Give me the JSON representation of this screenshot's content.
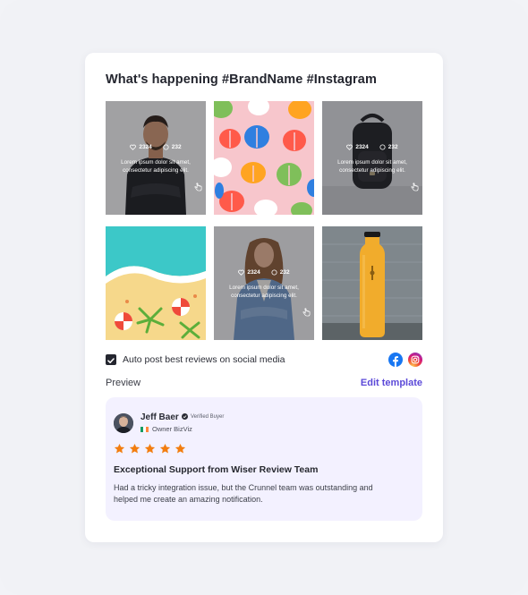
{
  "widget": {
    "title": "What's happening #BrandName #Instagram"
  },
  "posts": [
    {
      "image": "man-in-black-shirt",
      "likes": "2324",
      "comments": "232",
      "caption_line1": "Lorem ipsum dolor sit amet,",
      "caption_line2": "consectetur adipiscing elit."
    },
    {
      "image": "monstera-leaf-pattern"
    },
    {
      "image": "black-backpack",
      "likes": "2324",
      "comments": "232",
      "caption_line1": "Lorem ipsum dolor sit amet,",
      "caption_line2": "consectetur adipiscing elit."
    },
    {
      "image": "beach-aerial-view"
    },
    {
      "image": "smiling-woman-denim-jacket",
      "likes": "2324",
      "comments": "232",
      "caption_line1": "Lorem ipsum dolor sit amet,",
      "caption_line2": "consectetur adipiscing elit."
    },
    {
      "image": "yellow-water-bottle"
    }
  ],
  "autopost": {
    "label": "Auto post best reviews on social media",
    "checked": true,
    "icons": [
      "facebook-icon",
      "instagram-icon"
    ]
  },
  "preview": {
    "label": "Preview",
    "edit_label": "Edit template"
  },
  "review": {
    "name": "Jeff Baer",
    "verified_label": "Verified Buyer",
    "role": "Owner BizViz",
    "rating": 5,
    "title": "Exceptional Support from Wiser Review Team",
    "body_line1": "Had a tricky integration issue, but the Crunnel team was outstanding and",
    "body_line2": "helped me create an amazing notification."
  },
  "colors": {
    "accent": "#5b49d8",
    "star": "#f27d0f",
    "review_bg": "#f3f1ff",
    "facebook": "#1877f2"
  }
}
